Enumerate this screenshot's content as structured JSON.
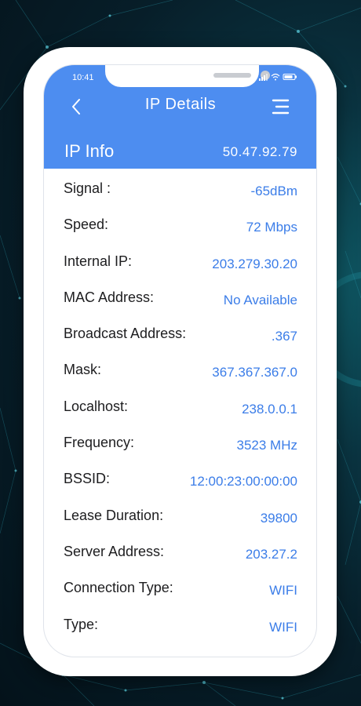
{
  "status_bar": {
    "time": "10:41"
  },
  "header": {
    "title": "IP Details"
  },
  "ip_info": {
    "label": "IP Info",
    "value": "50.47.92.79"
  },
  "details": [
    {
      "label": "Signal :",
      "value": "-65dBm"
    },
    {
      "label": "Speed:",
      "value": "72 Mbps"
    },
    {
      "label": "Internal IP:",
      "value": "203.279.30.20"
    },
    {
      "label": "MAC Address:",
      "value": "No Available"
    },
    {
      "label": "Broadcast Address:",
      "value": ".367"
    },
    {
      "label": "Mask:",
      "value": "367.367.367.0"
    },
    {
      "label": "Localhost:",
      "value": "238.0.0.1"
    },
    {
      "label": "Frequency:",
      "value": "3523 MHz"
    },
    {
      "label": "BSSID:",
      "value": "12:00:23:00:00:00"
    },
    {
      "label": "Lease Duration:",
      "value": "39800"
    },
    {
      "label": "Server Address:",
      "value": "203.27.2"
    },
    {
      "label": "Connection Type:",
      "value": "WIFI"
    },
    {
      "label": "Type:",
      "value": "WIFI"
    }
  ],
  "icons": {
    "back": "chevron-left-icon",
    "menu": "menu-icon",
    "signal": "signal-icon",
    "wifi": "wifi-icon",
    "battery": "battery-icon"
  },
  "colors": {
    "header": "#4d8df0",
    "value_text": "#3b7de8",
    "label_text": "#1d1d1f",
    "background": "#071e29"
  }
}
